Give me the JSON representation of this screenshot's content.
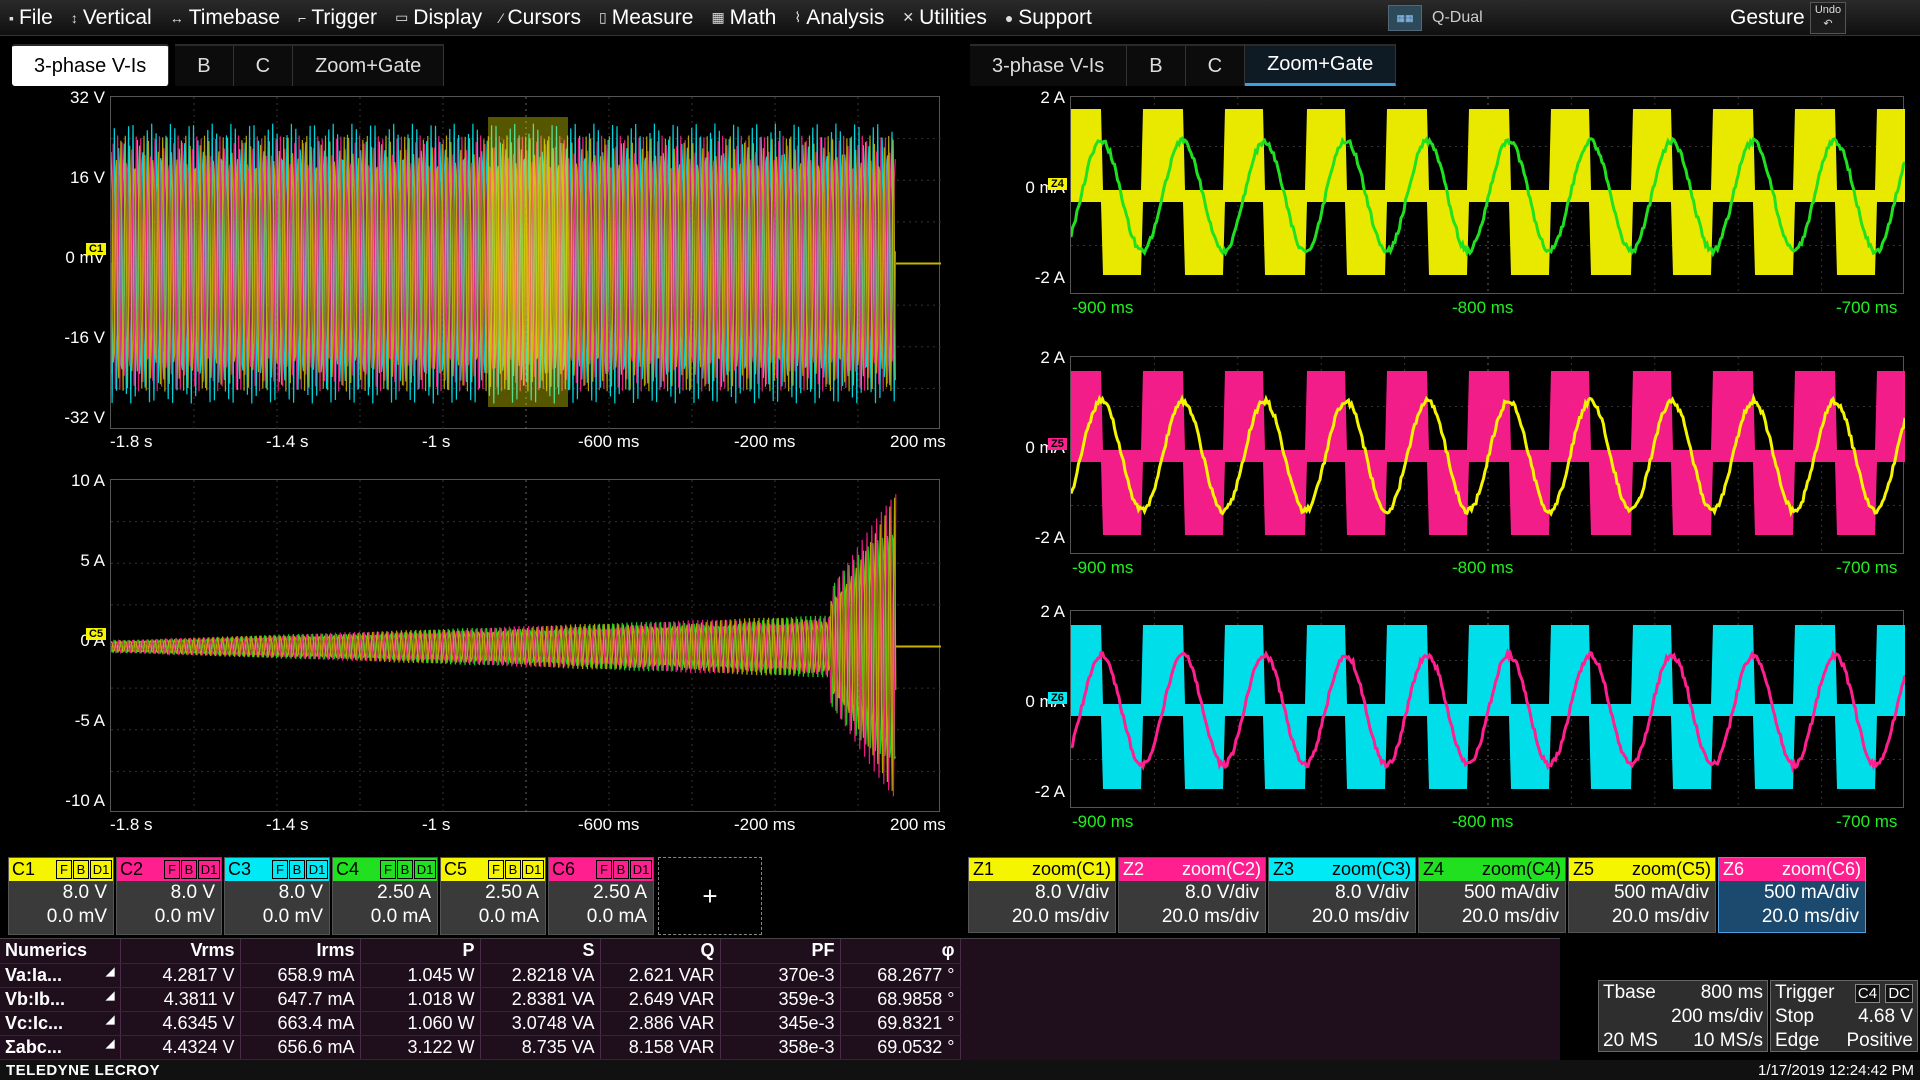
{
  "menu": [
    {
      "icon": "file-icon",
      "glyph": "▪",
      "label": "File"
    },
    {
      "icon": "vertical-icon",
      "glyph": "↕",
      "label": "Vertical"
    },
    {
      "icon": "timebase-icon",
      "glyph": "↔",
      "label": "Timebase"
    },
    {
      "icon": "trigger-icon",
      "glyph": "⌐",
      "label": "Trigger"
    },
    {
      "icon": "display-icon",
      "glyph": "▭",
      "label": "Display"
    },
    {
      "icon": "cursors-icon",
      "glyph": "⁄",
      "label": "Cursors"
    },
    {
      "icon": "measure-icon",
      "glyph": "▯",
      "label": "Measure"
    },
    {
      "icon": "math-icon",
      "glyph": "▦",
      "label": "Math"
    },
    {
      "icon": "analysis-icon",
      "glyph": "⌇",
      "label": "Analysis"
    },
    {
      "icon": "utilities-icon",
      "glyph": "✕",
      "label": "Utilities"
    },
    {
      "icon": "support-icon",
      "glyph": "●",
      "label": "Support"
    }
  ],
  "qdual": "Q-Dual",
  "gesture": "Gesture",
  "undo": "Undo",
  "tabs_left": [
    "3-phase V-Is",
    "B",
    "C",
    "Zoom+Gate"
  ],
  "tabs_right": [
    "3-phase V-Is",
    "B",
    "C",
    "Zoom+Gate"
  ],
  "grid_voltage": {
    "ylabels": [
      "32 V",
      "16 V",
      "0 mV",
      "-16 V",
      "-32 V"
    ],
    "xlabels": [
      "-1.8 s",
      "-1.4 s",
      "-1 s",
      "-600 ms",
      "-200 ms",
      "200 ms"
    ],
    "marker": "C1"
  },
  "grid_current": {
    "ylabels": [
      "10 A",
      "5 A",
      "0 A",
      "-5 A",
      "-10 A"
    ],
    "xlabels": [
      "-1.8 s",
      "-1.4 s",
      "-1 s",
      "-600 ms",
      "-200 ms",
      "200 ms"
    ],
    "marker": "C5"
  },
  "zoom_grids": [
    {
      "ylabels": [
        "2 A",
        "0 mA",
        "-2 A"
      ],
      "xlabels": [
        "-900 ms",
        "-800 ms",
        "-700 ms"
      ],
      "marker": "Z4",
      "square": "#f5f500",
      "sine": "#20e020"
    },
    {
      "ylabels": [
        "2 A",
        "0 mA",
        "-2 A"
      ],
      "xlabels": [
        "-900 ms",
        "-800 ms",
        "-700 ms"
      ],
      "marker": "Z5",
      "square": "#ff1f8f",
      "sine": "#f5f500"
    },
    {
      "ylabels": [
        "2 A",
        "0 mA",
        "-2 A"
      ],
      "xlabels": [
        "-900 ms",
        "-800 ms",
        "-700 ms"
      ],
      "marker": "Z6",
      "square": "#00eaf5",
      "sine": "#ff1f8f"
    }
  ],
  "channels": [
    {
      "name": "C1",
      "color": "#f5f500",
      "scale": "8.0 V",
      "offset": "0.0 mV"
    },
    {
      "name": "C2",
      "color": "#ff1f8f",
      "scale": "8.0 V",
      "offset": "0.0 mV"
    },
    {
      "name": "C3",
      "color": "#00eaf5",
      "scale": "8.0 V",
      "offset": "0.0 mV"
    },
    {
      "name": "C4",
      "color": "#20e020",
      "scale": "2.50 A",
      "offset": "0.0 mA"
    },
    {
      "name": "C5",
      "color": "#f5f500",
      "scale": "2.50 A",
      "offset": "0.0 mA"
    },
    {
      "name": "C6",
      "color": "#ff1f8f",
      "scale": "2.50 A",
      "offset": "0.0 mA"
    }
  ],
  "channel_flags": [
    "F",
    "B",
    "D1"
  ],
  "add_label": "+",
  "zooms": [
    {
      "name": "Z1",
      "src": "zoom(C1)",
      "color": "#f5f500",
      "scale": "8.0 V/div",
      "time": "20.0 ms/div"
    },
    {
      "name": "Z2",
      "src": "zoom(C2)",
      "color": "#ff1f8f",
      "scale": "8.0 V/div",
      "time": "20.0 ms/div"
    },
    {
      "name": "Z3",
      "src": "zoom(C3)",
      "color": "#00eaf5",
      "scale": "8.0 V/div",
      "time": "20.0 ms/div"
    },
    {
      "name": "Z4",
      "src": "zoom(C4)",
      "color": "#20e020",
      "scale": "500 mA/div",
      "time": "20.0 ms/div"
    },
    {
      "name": "Z5",
      "src": "zoom(C5)",
      "color": "#f5f500",
      "scale": "500 mA/div",
      "time": "20.0 ms/div"
    },
    {
      "name": "Z6",
      "src": "zoom(C6)",
      "color": "#ff1f8f",
      "scale": "500 mA/div",
      "time": "20.0 ms/div"
    }
  ],
  "numerics": {
    "title": "Numerics",
    "headers": [
      "Vrms",
      "Irms",
      "P",
      "S",
      "Q",
      "PF",
      "φ"
    ],
    "rows": [
      {
        "name": "Va:Ia...",
        "vals": [
          "4.2817 V",
          "658.9 mA",
          "1.045 W",
          "2.8218 VA",
          "2.621 VAR",
          "370e-3",
          "68.2677 °"
        ]
      },
      {
        "name": "Vb:Ib...",
        "vals": [
          "4.3811 V",
          "647.7 mA",
          "1.018 W",
          "2.8381 VA",
          "2.649 VAR",
          "359e-3",
          "68.9858 °"
        ]
      },
      {
        "name": "Vc:Ic...",
        "vals": [
          "4.6345 V",
          "663.4 mA",
          "1.060 W",
          "3.0748 VA",
          "2.886 VAR",
          "345e-3",
          "69.8321 °"
        ]
      },
      {
        "name": "Σabc...",
        "vals": [
          "4.4324 V",
          "656.6 mA",
          "3.122 W",
          "8.735 VA",
          "8.158 VAR",
          "358e-3",
          "69.0532 °"
        ]
      }
    ]
  },
  "timebase": {
    "label": "Tbase",
    "delay": "800 ms",
    "div": "200 ms/div",
    "samples": "20 MS",
    "rate": "10 MS/s"
  },
  "trigger": {
    "label": "Trigger",
    "source": "C4",
    "coupling": "DC",
    "mode": "Stop",
    "level": "4.68 V",
    "type": "Edge",
    "slope": "Positive"
  },
  "footer": {
    "brand": "TELEDYNE LECROY",
    "datetime": "1/17/2019 12:24:42 PM"
  }
}
